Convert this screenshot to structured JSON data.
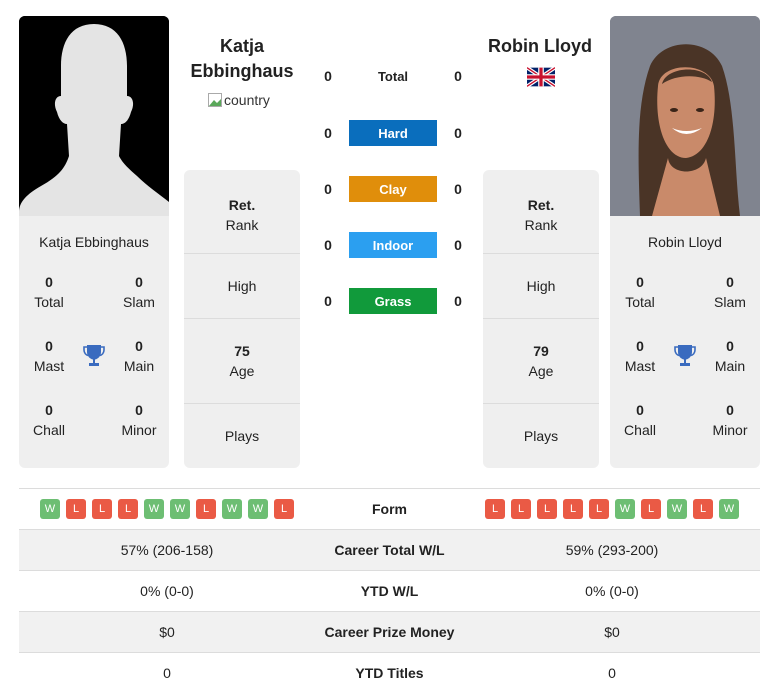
{
  "colors": {
    "hard": "#0a6ebd",
    "clay": "#e08e0b",
    "indoor": "#2b9ff0",
    "grass": "#119a3b",
    "win": "#6dbe73",
    "loss": "#ea5a45",
    "trophy": "#3a6bbf"
  },
  "player1": {
    "name": "Katja Ebbinghaus",
    "name_line1": "Katja",
    "name_line2": "Ebbinghaus",
    "country_alt": "country",
    "photo": "silhouette-placeholder",
    "titles": {
      "total": {
        "value": "0",
        "label": "Total"
      },
      "slam": {
        "value": "0",
        "label": "Slam"
      },
      "mast": {
        "value": "0",
        "label": "Mast"
      },
      "main": {
        "value": "0",
        "label": "Main"
      },
      "chall": {
        "value": "0",
        "label": "Chall"
      },
      "minor": {
        "value": "0",
        "label": "Minor"
      }
    },
    "info": {
      "rank_value": "Ret.",
      "rank_label": "Rank",
      "high_label": "High",
      "age_value": "75",
      "age_label": "Age",
      "plays_label": "Plays"
    },
    "form": [
      "W",
      "L",
      "L",
      "L",
      "W",
      "W",
      "L",
      "W",
      "W",
      "L"
    ],
    "career_wl": "57% (206-158)",
    "ytd_wl": "0% (0-0)",
    "prize": "$0",
    "ytd_titles": "0"
  },
  "player2": {
    "name": "Robin Lloyd",
    "country_flag": "uk-flag",
    "photo": "player-photo",
    "titles": {
      "total": {
        "value": "0",
        "label": "Total"
      },
      "slam": {
        "value": "0",
        "label": "Slam"
      },
      "mast": {
        "value": "0",
        "label": "Mast"
      },
      "main": {
        "value": "0",
        "label": "Main"
      },
      "chall": {
        "value": "0",
        "label": "Chall"
      },
      "minor": {
        "value": "0",
        "label": "Minor"
      }
    },
    "info": {
      "rank_value": "Ret.",
      "rank_label": "Rank",
      "high_label": "High",
      "age_value": "79",
      "age_label": "Age",
      "plays_label": "Plays"
    },
    "form": [
      "L",
      "L",
      "L",
      "L",
      "L",
      "W",
      "L",
      "W",
      "L",
      "W"
    ],
    "career_wl": "59% (293-200)",
    "ytd_wl": "0% (0-0)",
    "prize": "$0",
    "ytd_titles": "0"
  },
  "h2h": {
    "total": {
      "label": "Total",
      "p1": "0",
      "p2": "0"
    },
    "hard": {
      "label": "Hard",
      "p1": "0",
      "p2": "0"
    },
    "clay": {
      "label": "Clay",
      "p1": "0",
      "p2": "0"
    },
    "indoor": {
      "label": "Indoor",
      "p1": "0",
      "p2": "0"
    },
    "grass": {
      "label": "Grass",
      "p1": "0",
      "p2": "0"
    }
  },
  "table": {
    "form_label": "Form",
    "career_label": "Career Total W/L",
    "ytd_label": "YTD W/L",
    "prize_label": "Career Prize Money",
    "titles_label": "YTD Titles"
  }
}
